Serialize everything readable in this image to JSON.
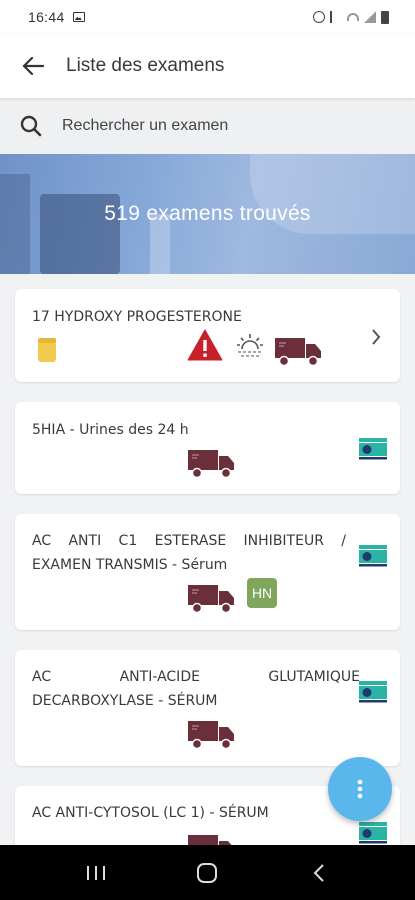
{
  "status_bar": {
    "time": "16:44"
  },
  "app_bar": {
    "title": "Liste des examens"
  },
  "search": {
    "placeholder": "Rechercher un examen"
  },
  "banner": {
    "text": "519 examens trouvés"
  },
  "exams": [
    {
      "name": "17 HYDROXY PROGESTERONE",
      "icons": [
        "tube-icon",
        "warning-icon",
        "sunrise-icon",
        "truck-4h-icon",
        "chevron-right-icon"
      ]
    },
    {
      "name": "5HIA - Urines des 24 h",
      "icons": [
        "truck-4h-icon",
        "document-icon"
      ]
    },
    {
      "name_line1": "AC ANTI C1 ESTERASE INHIBITEUR /",
      "name_line2": "EXAMEN TRANSMIS - Sérum",
      "badge": "HN",
      "icons": [
        "truck-4h-icon",
        "hn-badge",
        "document-icon"
      ]
    },
    {
      "name_line1": "AC ANTI-ACIDE GLUTAMIQUE",
      "name_line2": "DECARBOXYLASE - SÉRUM",
      "icons": [
        "truck-4h-icon",
        "document-icon"
      ]
    },
    {
      "name": "AC ANTI-CYTOSOL (LC 1) - SÉRUM",
      "icons": [
        "truck-4h-icon",
        "document-icon"
      ]
    }
  ],
  "colors": {
    "truck": "#6b2f3c",
    "accent_fab": "#5ab7ec",
    "hn_badge": "#7fa65a",
    "warning": "#c8202b",
    "tube": "#f2c94c",
    "doc_teal": "#2bb3a3",
    "doc_navy": "#1f3b6b"
  }
}
